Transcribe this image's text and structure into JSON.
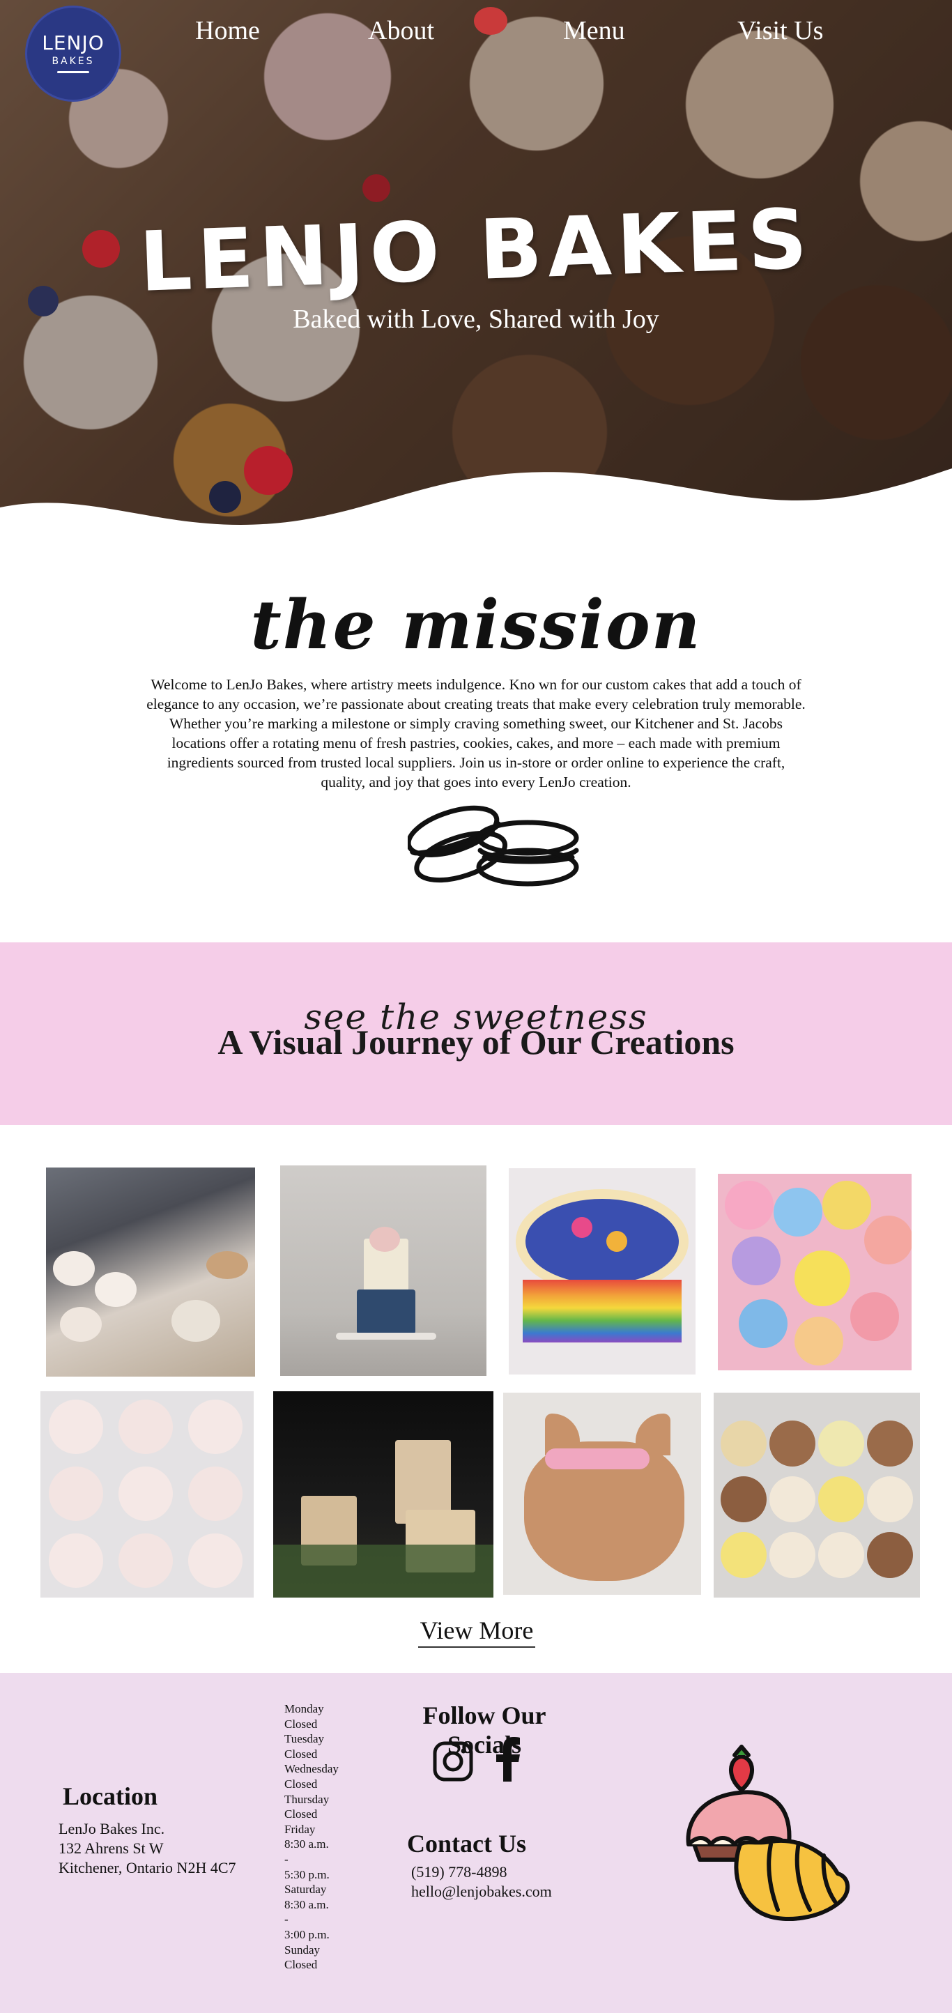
{
  "brand": {
    "logo_main": "LENJO",
    "logo_sub": "BAKES"
  },
  "nav": {
    "items": [
      "Home",
      "About",
      "Menu",
      "Visit Us"
    ]
  },
  "hero": {
    "title": "LENJO BAKES",
    "tagline": "Baked with Love, Shared with Joy"
  },
  "mission": {
    "title": "the mission",
    "text": "Welcome to LenJo Bakes, where artistry meets indulgence. Kno wn for our custom cakes that add a touch of elegance to any occasion, we’re passionate about creating treats that make every celebration truly memorable. Whether you’re marking a milestone or simply craving something sweet, our Kitchener and St. Jacobs locations offer a rotating menu of fresh pastries, cookies, cakes, and more – each made with premium ingredients sourced from trusted local suppliers. Join us in-store or order online to experience the craft, quality, and joy that goes into every LenJo creation.",
    "icon": "macaron-icon"
  },
  "gallery": {
    "script": "see the sweetness",
    "heading": "A Visual Journey of Our Creations",
    "view_more": "View More"
  },
  "location": {
    "title": "Location",
    "lines": [
      "LenJo Bakes Inc.",
      "132 Ahrens St W",
      "Kitchener, Ontario N2H 4C7"
    ]
  },
  "hours": {
    "lines": [
      "Monday",
      "Closed",
      "Tuesday",
      "Closed",
      "Wednesday",
      "Closed",
      "Thursday",
      "Closed",
      "Friday",
      "8:30 a.m.",
      "-",
      "5:30 p.m.",
      "Saturday",
      "8:30 a.m.",
      "-",
      "3:00 p.m.",
      "Sunday",
      "Closed"
    ]
  },
  "socials": {
    "title": "Follow Our Socials",
    "icons": [
      "instagram-icon",
      "facebook-icon"
    ]
  },
  "contact": {
    "title": "Contact Us",
    "phone": "(519) 778-4898",
    "email": "hello@lenjobakes.com"
  },
  "colors": {
    "logo_bg": "#2a3884",
    "gallery_band": "#f5cde8",
    "footer_bg": "#eedcee"
  }
}
